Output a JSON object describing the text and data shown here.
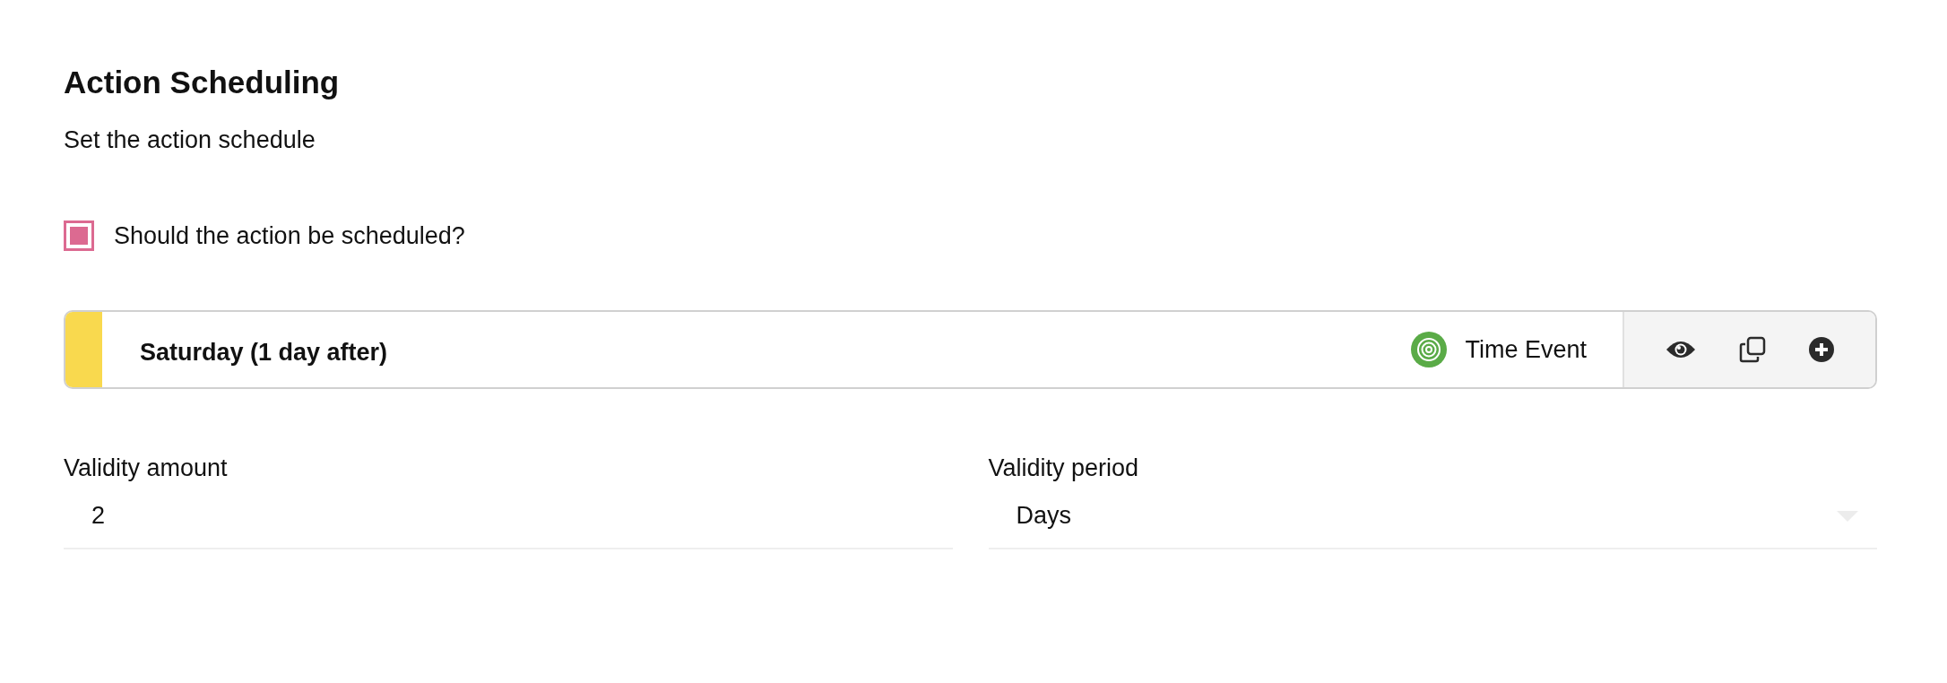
{
  "section": {
    "title": "Action Scheduling",
    "subtitle": "Set the action schedule"
  },
  "schedule_checkbox": {
    "label": "Should the action be scheduled?",
    "checked": true
  },
  "event_card": {
    "title": "Saturday (1 day after)",
    "color": "#f9d94e",
    "event_type": "Time Event"
  },
  "fields": [
    {
      "kind": "text",
      "label": "Validity amount",
      "value": "2"
    },
    {
      "kind": "select",
      "label": "Validity period",
      "value": "Days"
    }
  ]
}
